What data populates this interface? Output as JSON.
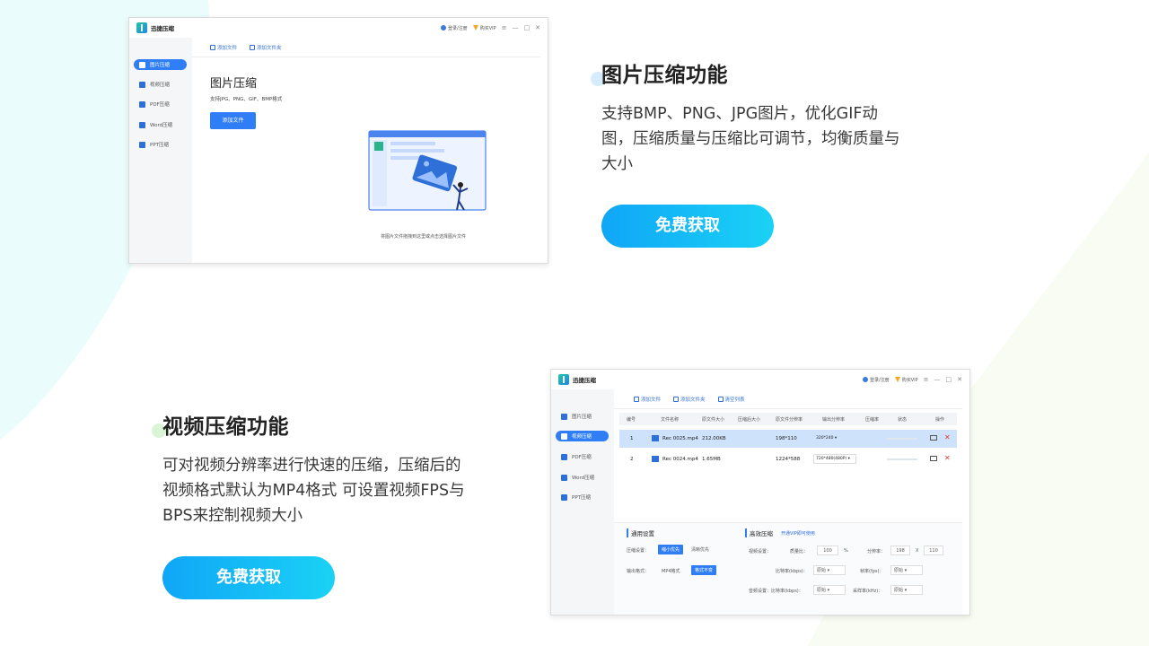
{
  "sections": [
    {
      "title": "图片压缩功能",
      "desc_lines": [
        "支持BMP、PNG、JPG图片，优化GIF动",
        "图，压缩质量与压缩比可调节，均衡质量与",
        "大小"
      ],
      "cta": "免费获取"
    },
    {
      "title": "视频压缩功能",
      "desc_lines": [
        "可对视频分辨率进行快速的压缩，压缩后的",
        "视频格式默认为MP4格式 可设置视频FPS与",
        "BPS来控制视频大小"
      ],
      "cta": "免费获取"
    }
  ],
  "app": {
    "name": "迅捷压缩",
    "login": "登录/注册",
    "vip": "购买VIP",
    "win_menu": "≡",
    "win_min": "—",
    "win_max": "□",
    "win_close": "✕",
    "sidebar": [
      "图片压缩",
      "视频压缩",
      "PDF压缩",
      "Word压缩",
      "PPT压缩"
    ],
    "toolbar_add_file": "添加文件",
    "toolbar_add_folder": "添加文件夹",
    "toolbar_clear": "清空列表"
  },
  "image_panel": {
    "heading": "图片压缩",
    "formats": "支持JPG、PNG、GIF、BMP格式",
    "add_button": "添加文件",
    "drop_hint": "将图片文件拖拽到这里或点击选择图片文件"
  },
  "video_panel": {
    "columns": [
      "编号",
      "文件名称",
      "原文件大小",
      "压缩后大小",
      "原文件分辨率",
      "输出分辨率",
      "压缩率",
      "状态",
      "操作"
    ],
    "rows": [
      {
        "num": "1",
        "name": "Rec 0025.mp4",
        "size": "212.00KB",
        "res": "198*110",
        "out": "320*240"
      },
      {
        "num": "2",
        "name": "Rec 0024.mp4",
        "size": "1.65MB",
        "res": "1224*588",
        "out": "720*480(480P)"
      }
    ],
    "general_title": "通用设置",
    "compress_label": "压缩设置：",
    "compress_opt1": "缩小优先",
    "compress_opt2": "清晰优先",
    "output_label": "输出格式：",
    "output_opt1": "MP4格式",
    "output_opt2": "格式不变",
    "eff_title": "高效压缩",
    "eff_vip": "开通VIP即可使用",
    "video_setting": "视频设置：",
    "quality_label": "质量比：",
    "quality_val": "100",
    "pct": "%",
    "res_label": "分辨率：",
    "res_w": "198",
    "res_x": "X",
    "res_h": "110",
    "bitrate_label": "比特率(kbps)：",
    "fps_label": "帧率(fps)：",
    "audio_setting": "音频设置：比特率(kbps)：",
    "sample_label": "采样率(kHz)：",
    "default_opt": "原始"
  }
}
